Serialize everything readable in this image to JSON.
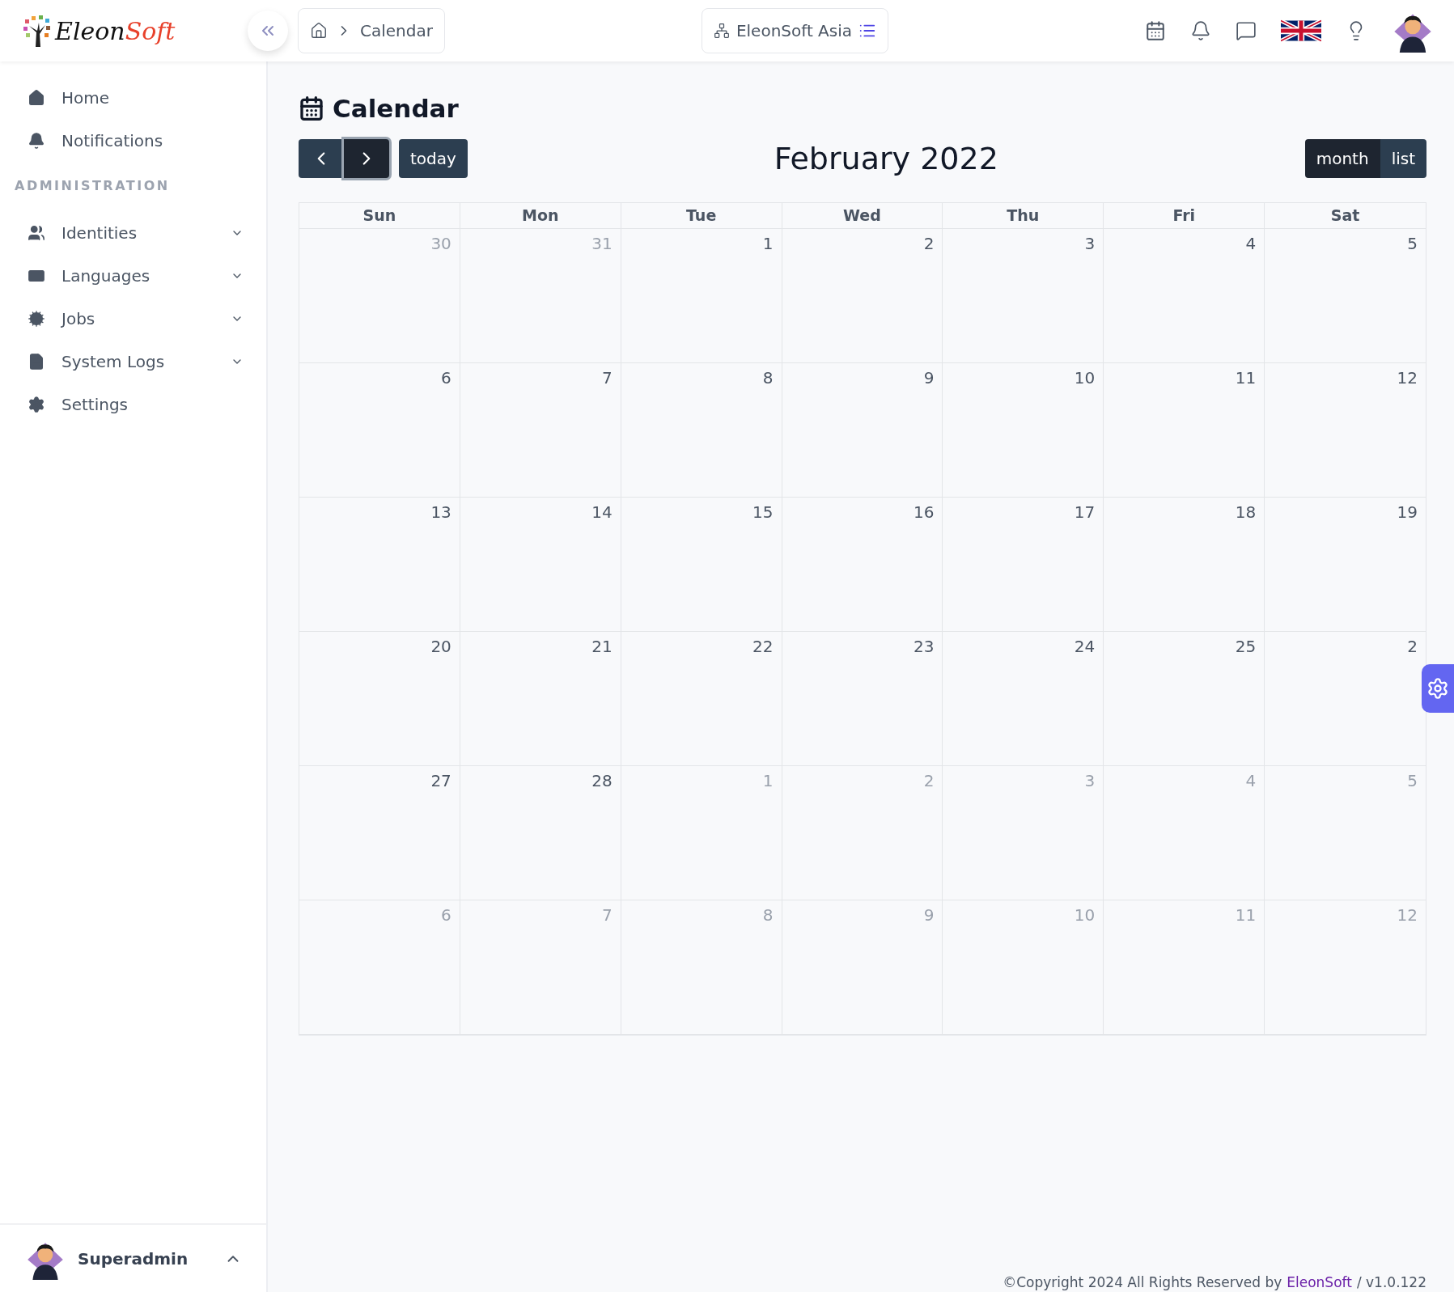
{
  "logo": {
    "part_1": "Eleon",
    "part_2": "Soft"
  },
  "breadcrumb": {
    "current": "Calendar"
  },
  "tenant": {
    "name": "EleonSoft Asia"
  },
  "sidebar": {
    "items": [
      {
        "label": "Home",
        "expandable": false
      },
      {
        "label": "Notifications",
        "expandable": false
      }
    ],
    "section": "ADMINISTRATION",
    "admin_items": [
      {
        "label": "Identities",
        "expandable": true
      },
      {
        "label": "Languages",
        "expandable": true
      },
      {
        "label": "Jobs",
        "expandable": true
      },
      {
        "label": "System Logs",
        "expandable": true
      },
      {
        "label": "Settings",
        "expandable": false
      }
    ],
    "user": {
      "name": "Superadmin",
      "expanded": true
    }
  },
  "page": {
    "title": "Calendar"
  },
  "calendar": {
    "title": "February 2022",
    "today_button": "today",
    "nav": [
      {
        "focused": false
      },
      {
        "focused": true
      }
    ],
    "views": [
      {
        "label": "month",
        "selected": true
      },
      {
        "label": "list",
        "selected": false
      }
    ],
    "weekdays": [
      "Sun",
      "Mon",
      "Tue",
      "Wed",
      "Thu",
      "Fri",
      "Sat"
    ],
    "weeks": [
      {
        "days": [
          {
            "day": "30",
            "other_month": true
          },
          {
            "day": "31",
            "other_month": true
          },
          {
            "day": "1",
            "other_month": false
          },
          {
            "day": "2",
            "other_month": false
          },
          {
            "day": "3",
            "other_month": false
          },
          {
            "day": "4",
            "other_month": false
          },
          {
            "day": "5",
            "other_month": false
          }
        ]
      },
      {
        "days": [
          {
            "day": "6",
            "other_month": false
          },
          {
            "day": "7",
            "other_month": false
          },
          {
            "day": "8",
            "other_month": false
          },
          {
            "day": "9",
            "other_month": false
          },
          {
            "day": "10",
            "other_month": false
          },
          {
            "day": "11",
            "other_month": false
          },
          {
            "day": "12",
            "other_month": false
          }
        ]
      },
      {
        "days": [
          {
            "day": "13",
            "other_month": false
          },
          {
            "day": "14",
            "other_month": false
          },
          {
            "day": "15",
            "other_month": false
          },
          {
            "day": "16",
            "other_month": false
          },
          {
            "day": "17",
            "other_month": false
          },
          {
            "day": "18",
            "other_month": false
          },
          {
            "day": "19",
            "other_month": false
          }
        ]
      },
      {
        "days": [
          {
            "day": "20",
            "other_month": false
          },
          {
            "day": "21",
            "other_month": false
          },
          {
            "day": "22",
            "other_month": false
          },
          {
            "day": "23",
            "other_month": false
          },
          {
            "day": "24",
            "other_month": false
          },
          {
            "day": "25",
            "other_month": false
          },
          {
            "day": "2",
            "other_month": false
          }
        ]
      },
      {
        "days": [
          {
            "day": "27",
            "other_month": false
          },
          {
            "day": "28",
            "other_month": false
          },
          {
            "day": "1",
            "other_month": true
          },
          {
            "day": "2",
            "other_month": true
          },
          {
            "day": "3",
            "other_month": true
          },
          {
            "day": "4",
            "other_month": true
          },
          {
            "day": "5",
            "other_month": true
          }
        ]
      },
      {
        "days": [
          {
            "day": "6",
            "other_month": true
          },
          {
            "day": "7",
            "other_month": true
          },
          {
            "day": "8",
            "other_month": true
          },
          {
            "day": "9",
            "other_month": true
          },
          {
            "day": "10",
            "other_month": true
          },
          {
            "day": "11",
            "other_month": true
          },
          {
            "day": "12",
            "other_month": true
          }
        ]
      }
    ]
  },
  "footer": {
    "text": "©Copyright 2024 All Rights Reserved by",
    "link": "EleonSoft",
    "version": "/ v1.0.122"
  }
}
